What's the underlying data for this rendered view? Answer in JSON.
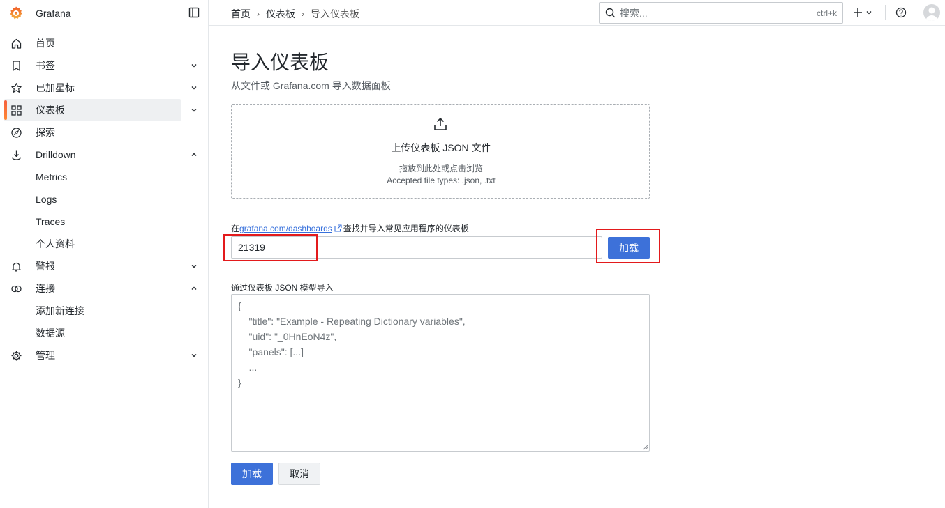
{
  "app": {
    "brand": "Grafana"
  },
  "sidebar": {
    "items": [
      {
        "label": "首页",
        "icon": "home-icon"
      },
      {
        "label": "书签",
        "icon": "bookmark-icon"
      },
      {
        "label": "已加星标",
        "icon": "star-icon"
      },
      {
        "label": "仪表板",
        "icon": "apps-icon",
        "active": true
      },
      {
        "label": "探索",
        "icon": "compass-icon"
      },
      {
        "label": "Drilldown",
        "icon": "drilldown-icon"
      },
      {
        "label": "Metrics"
      },
      {
        "label": "Logs"
      },
      {
        "label": "Traces"
      },
      {
        "label": "个人资料"
      },
      {
        "label": "警报",
        "icon": "bell-icon"
      },
      {
        "label": "连接",
        "icon": "link-icon"
      },
      {
        "label": "添加新连接"
      },
      {
        "label": "数据源"
      },
      {
        "label": "管理",
        "icon": "cog-icon"
      }
    ]
  },
  "topbar": {
    "breadcrumbs": [
      "首页",
      "仪表板",
      "导入仪表板"
    ],
    "search_placeholder": "搜索...",
    "search_shortcut": "ctrl+k"
  },
  "page": {
    "title": "导入仪表板",
    "subtitle": "从文件或 Grafana.com 导入数据面板"
  },
  "upload": {
    "title": "上传仪表板 JSON 文件",
    "hint": "拖放到此处或点击浏览",
    "types": "Accepted file types: .json, .txt"
  },
  "grafana_com": {
    "label_prefix": "在",
    "link_text": "grafana.com/dashboards",
    "label_suffix": "查找并导入常见应用程序的仪表板",
    "input_value": "21319",
    "load_label": "加载"
  },
  "json_model": {
    "label": "通过仪表板 JSON 模型导入",
    "placeholder": "{\n    \"title\": \"Example - Repeating Dictionary variables\",\n    \"uid\": \"_0HnEoN4z\",\n    \"panels\": [...]\n    ...\n}"
  },
  "actions": {
    "load_label": "加载",
    "cancel_label": "取消"
  },
  "colors": {
    "accent": "#3d71d9",
    "active_bar": "#f55f3e",
    "highlight": "#e31a1c"
  }
}
